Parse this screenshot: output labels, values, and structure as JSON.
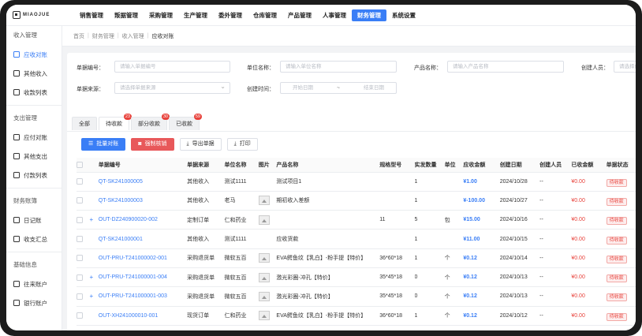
{
  "app": {
    "logo": "MIAOJUE"
  },
  "nav": [
    "销售管理",
    "叛据管理",
    "采购管理",
    "生产管理",
    "委外管理",
    "仓库管理",
    "产品管理",
    "人事管理",
    "财务管理",
    "系统设置"
  ],
  "nav_active": 8,
  "sidebar": {
    "groups": [
      {
        "title": "收入管理",
        "items": [
          "应收对账",
          "其他收入",
          "收款列表"
        ]
      },
      {
        "title": "支出管理",
        "items": [
          "应付对账",
          "其他支出",
          "付款列表"
        ]
      },
      {
        "title": "财务账簿",
        "items": [
          "日记账",
          "收支汇总"
        ]
      },
      {
        "title": "基础信息",
        "items": [
          "往来账户",
          "银行账户"
        ]
      }
    ],
    "active": "应收对账"
  },
  "breadcrumb": [
    "首页",
    "财务管理",
    "收入管理",
    "应收对账"
  ],
  "filters": {
    "doc_no_label": "单据编号：",
    "doc_no_placeholder": "请输入单据编号",
    "unit_label": "单位名称：",
    "unit_placeholder": "请输入单位名称",
    "product_label": "产品名称：",
    "product_placeholder": "请输入产品名称",
    "creator_label": "创建人员：",
    "creator_placeholder": "请选择创建",
    "source_label": "单据来源：",
    "source_placeholder": "请选择单据来源",
    "time_label": "创建时间：",
    "start_placeholder": "开始日期",
    "sep": "~",
    "end_placeholder": "结束日期"
  },
  "tabs": [
    {
      "label": "全部",
      "badge": ""
    },
    {
      "label": "待收款",
      "badge": "23"
    },
    {
      "label": "部分收款",
      "badge": "30"
    },
    {
      "label": "已收款",
      "badge": "59"
    }
  ],
  "toolbar": {
    "batch": "批量对账",
    "force": "强制核销",
    "export": "导出单据",
    "print": "打印"
  },
  "table": {
    "columns": [
      "单据编号",
      "单据来源",
      "单位名称",
      "图片",
      "产品名称",
      "规格型号",
      "实发数量",
      "单位",
      "应收金额",
      "创建日期",
      "创建人员",
      "已收金额",
      "单据状态"
    ],
    "rows": [
      {
        "plus": false,
        "no": "QT-SK241000005",
        "source": "其他收入",
        "unit": "测试1111",
        "img": false,
        "product": "测试项目1",
        "spec": "",
        "qty": "1",
        "uom": "",
        "amount": "¥1.00",
        "date": "2024/10/28",
        "creator": "--",
        "received": "¥0.00",
        "status": "待收款"
      },
      {
        "plus": false,
        "no": "QT-SK241000003",
        "source": "其他收入",
        "unit": "老马",
        "img": true,
        "product": "期初收入差额",
        "spec": "",
        "qty": "1",
        "uom": "",
        "amount": "¥-100.00",
        "date": "2024/10/27",
        "creator": "--",
        "received": "¥0.00",
        "status": "待收款"
      },
      {
        "plus": true,
        "no": "OUT-DZ240900020-002",
        "source": "定制订单",
        "unit": "仁和药业",
        "img": true,
        "product": "",
        "spec": "11",
        "qty": "5",
        "uom": "包",
        "amount": "¥15.00",
        "date": "2024/10/16",
        "creator": "--",
        "received": "¥0.00",
        "status": "待收款"
      },
      {
        "plus": false,
        "no": "QT-SK241000001",
        "source": "其他收入",
        "unit": "测试1111",
        "img": false,
        "product": "应收货款",
        "spec": "",
        "qty": "1",
        "uom": "",
        "amount": "¥11.00",
        "date": "2024/10/15",
        "creator": "--",
        "received": "¥0.00",
        "status": "待收款"
      },
      {
        "plus": false,
        "no": "OUT-PRU-T241000002-001",
        "source": "采购退货单",
        "unit": "微软五百",
        "img": true,
        "product": "EVA鳄鱼纹【乳白】-粉手提【特价】",
        "spec": "36*60*18",
        "qty": "1",
        "uom": "个",
        "amount": "¥0.12",
        "date": "2024/10/14",
        "creator": "--",
        "received": "¥0.00",
        "status": "待收款"
      },
      {
        "plus": true,
        "no": "OUT-PRU-T241000001-004",
        "source": "采购退货单",
        "unit": "微软五百",
        "img": true,
        "product": "激光彩圈-冲孔【特价】",
        "spec": "35*45*18",
        "qty": "0",
        "uom": "个",
        "amount": "¥0.12",
        "date": "2024/10/13",
        "creator": "--",
        "received": "¥0.00",
        "status": "待收款"
      },
      {
        "plus": true,
        "no": "OUT-PRU-T241000001-003",
        "source": "采购退货单",
        "unit": "微软五百",
        "img": true,
        "product": "激光彩圈-冲孔【特价】",
        "spec": "35*45*18",
        "qty": "0",
        "uom": "个",
        "amount": "¥0.12",
        "date": "2024/10/13",
        "creator": "--",
        "received": "¥0.00",
        "status": "待收款"
      },
      {
        "plus": false,
        "no": "OUT-XH241000010-001",
        "source": "现货订单",
        "unit": "仁和药业",
        "img": true,
        "product": "EVA鳄鱼纹【乳白】-粉手提【特价】",
        "spec": "36*60*18",
        "qty": "1",
        "uom": "个",
        "amount": "¥0.12",
        "date": "2024/10/12",
        "creator": "--",
        "received": "¥0.00",
        "status": "待收款"
      }
    ]
  },
  "colors": {
    "accent": "#3a7ef6",
    "danger": "#e8423b"
  }
}
